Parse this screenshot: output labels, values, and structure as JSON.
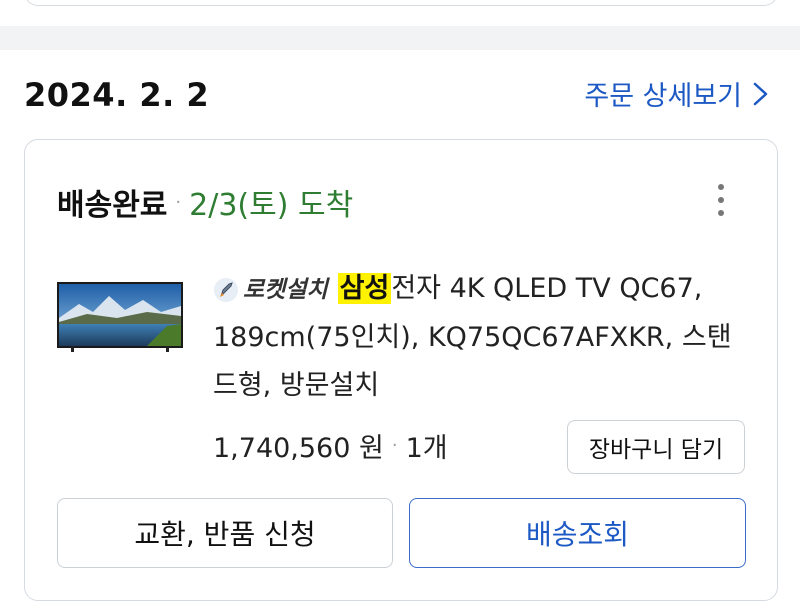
{
  "order": {
    "date": "2024. 2. 2",
    "detail_link": "주문 상세보기"
  },
  "shipment": {
    "status": "배송완료",
    "separator": "·",
    "arrival": "2/3(토) 도착"
  },
  "product": {
    "badge_label": "로켓설치",
    "brand": "삼성",
    "name_rest": "전자 4K QLED TV QC67, 189cm(75인치), KQ75QC67AFXKR, 스탠드형, 방문설치",
    "price": "1,740,560 원",
    "price_separator": "·",
    "quantity": "1개",
    "image_icon": "tv-product-image"
  },
  "buttons": {
    "cart": "장바구니 담기",
    "exchange": "교환, 반품 신청",
    "track": "배송조회"
  },
  "colors": {
    "link": "#1d59c4",
    "arrival": "#2e7d32",
    "highlight": "#fff200"
  }
}
